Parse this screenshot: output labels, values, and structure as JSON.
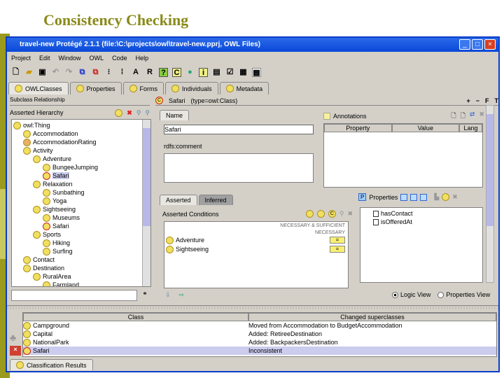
{
  "slide_title": "Consistency Checking",
  "window": {
    "title": "travel-new  Protégé 2.1.1     (file:\\C:\\projects\\owl\\travel-new.pprj, OWL Files)"
  },
  "menu": [
    "Project",
    "Edit",
    "Window",
    "OWL",
    "Code",
    "Help"
  ],
  "toolbar": {
    "a_label": "A",
    "r_label": "R"
  },
  "tabs": [
    {
      "label": "OWLClasses",
      "icon": "owl-classes-icon"
    },
    {
      "label": "Properties",
      "icon": "properties-icon"
    },
    {
      "label": "Forms",
      "icon": "forms-icon"
    },
    {
      "label": "Individuals",
      "icon": "individuals-icon"
    },
    {
      "label": "Metadata",
      "icon": "metadata-icon"
    }
  ],
  "left": {
    "header": "Subclass Relationship",
    "hierarchy_label": "Asserted Hierarchy",
    "tree": [
      {
        "label": "owl:Thing",
        "depth": 0,
        "kind": "normal"
      },
      {
        "label": "Accommodation",
        "depth": 1,
        "kind": "normal"
      },
      {
        "label": "AccommodationRating",
        "depth": 1,
        "kind": "orange"
      },
      {
        "label": "Activity",
        "depth": 1,
        "kind": "normal"
      },
      {
        "label": "Adventure",
        "depth": 2,
        "kind": "normal"
      },
      {
        "label": "BungeeJumping",
        "depth": 3,
        "kind": "normal"
      },
      {
        "label": "Safari",
        "depth": 3,
        "kind": "red",
        "selected": true
      },
      {
        "label": "Relaxation",
        "depth": 2,
        "kind": "normal"
      },
      {
        "label": "Sunbathing",
        "depth": 3,
        "kind": "normal"
      },
      {
        "label": "Yoga",
        "depth": 3,
        "kind": "normal"
      },
      {
        "label": "Sightseeing",
        "depth": 2,
        "kind": "normal"
      },
      {
        "label": "Museums",
        "depth": 3,
        "kind": "normal"
      },
      {
        "label": "Safari",
        "depth": 3,
        "kind": "red"
      },
      {
        "label": "Sports",
        "depth": 2,
        "kind": "normal"
      },
      {
        "label": "Hiking",
        "depth": 3,
        "kind": "normal"
      },
      {
        "label": "Surfing",
        "depth": 3,
        "kind": "normal"
      },
      {
        "label": "Contact",
        "depth": 1,
        "kind": "normal"
      },
      {
        "label": "Destination",
        "depth": 1,
        "kind": "normal"
      },
      {
        "label": "RuralArea",
        "depth": 2,
        "kind": "normal"
      },
      {
        "label": "Farmland",
        "depth": 3,
        "kind": "normal"
      }
    ],
    "search_value": ""
  },
  "right": {
    "class_name": "Safari",
    "class_type": "(type=owl:Class)",
    "header_controls": [
      "+",
      "−",
      "F",
      "T"
    ],
    "name_tab": "Name",
    "name_value": "Safari",
    "comment_label": "rdfs:comment",
    "annotations_label": "Annotations",
    "annotation_columns": [
      "Property",
      "Value",
      "Lang"
    ],
    "cond_tabs": [
      "Asserted",
      "Inferred"
    ],
    "conditions_label": "Asserted Conditions",
    "nec_suff": "NECESSARY & SUFFICIENT",
    "necessary": "NECESSARY",
    "conditions": [
      {
        "label": "Adventure",
        "btn": "="
      },
      {
        "label": "Sightseeing",
        "btn": "="
      }
    ],
    "properties_label": "Properties",
    "properties": [
      "hasContact",
      "isOfferedAt"
    ],
    "view_options": [
      {
        "label": "Logic View",
        "selected": true
      },
      {
        "label": "Properties View",
        "selected": false
      }
    ]
  },
  "results": {
    "columns": [
      "Class",
      "Changed superclasses"
    ],
    "rows": [
      {
        "class": "Campground",
        "change": "Moved from Accommodation to BudgetAccommodation",
        "kind": "normal"
      },
      {
        "class": "Capital",
        "change": "Added: RetireeDestination",
        "kind": "normal"
      },
      {
        "class": "NationalPark",
        "change": "Added: BackpackersDestination",
        "kind": "normal"
      },
      {
        "class": "Safari",
        "change": "Inconsistent",
        "kind": "red",
        "selected": true
      }
    ],
    "tab": "Classification Results"
  }
}
